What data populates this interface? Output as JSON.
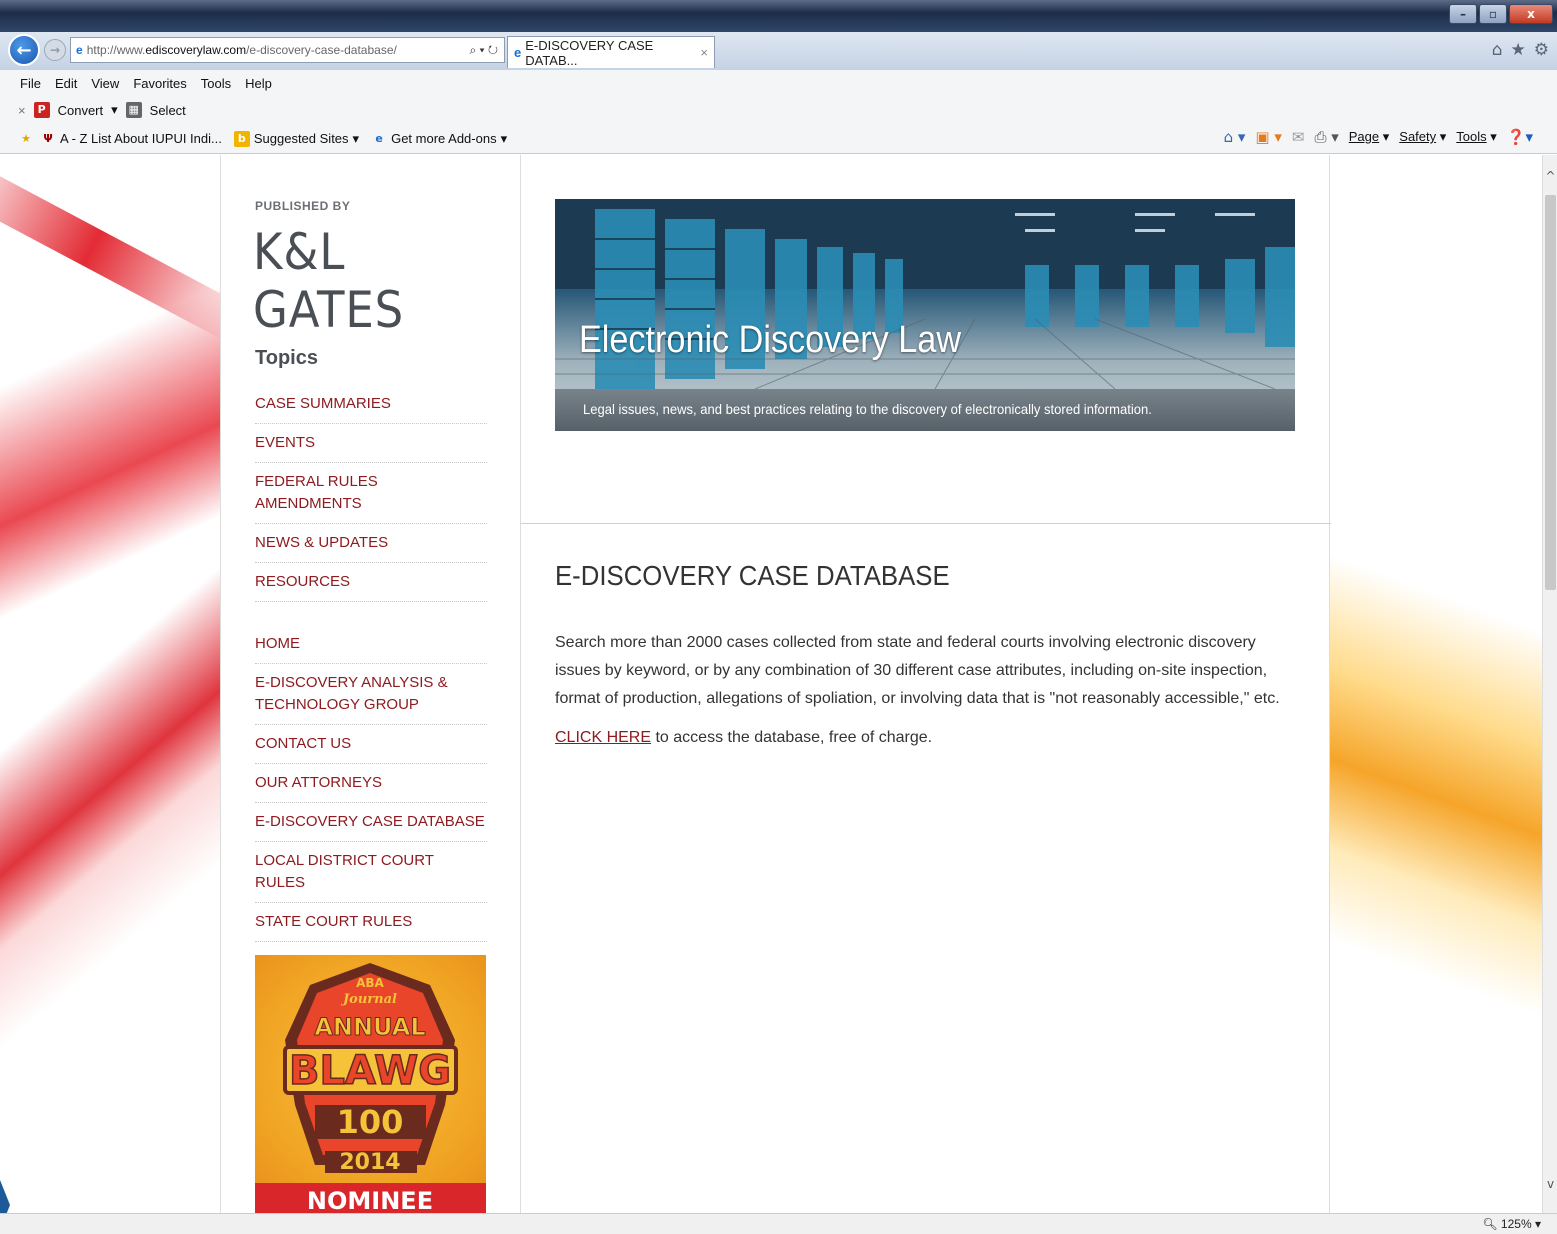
{
  "browser": {
    "url_prefix": "http://www.",
    "url_domain": "ediscoverylaw.com",
    "url_path": "/e-discovery-case-database/",
    "tab_title": "E-DISCOVERY CASE DATAB...",
    "tab_close": "×",
    "menu": [
      "File",
      "Edit",
      "View",
      "Favorites",
      "Tools",
      "Help"
    ],
    "cmd": {
      "close": "×",
      "convert": "Convert",
      "select": "Select"
    },
    "favorites": {
      "az_list": "A - Z List About IUPUI Indi...",
      "suggested": "Suggested Sites",
      "addons": "Get more Add-ons"
    },
    "right_cmds": {
      "page": "Page",
      "safety": "Safety",
      "tools": "Tools"
    },
    "zoom": "125%"
  },
  "sidebar": {
    "published_by": "PUBLISHED BY",
    "logo": "K&L GATES",
    "topics_heading": "Topics",
    "topics": [
      "CASE SUMMARIES",
      "EVENTS",
      "FEDERAL RULES AMENDMENTS",
      "NEWS & UPDATES",
      "RESOURCES"
    ],
    "links": [
      "HOME",
      "E-DISCOVERY ANALYSIS & TECHNOLOGY GROUP",
      "CONTACT US",
      "OUR ATTORNEYS",
      "E-DISCOVERY CASE DATABASE",
      "LOCAL DISTRICT COURT RULES",
      "STATE COURT RULES"
    ],
    "badge": {
      "top": "ABA",
      "journal": "Journal",
      "annual": "ANNUAL",
      "blawg": "BLAWG",
      "hundred": "100",
      "year": "2014",
      "nominee": "NOMINEE"
    }
  },
  "main": {
    "hero_title": "Electronic Discovery Law",
    "hero_tagline": "Legal issues, news, and best practices relating to the discovery of electronically stored information.",
    "page_title": "E-DISCOVERY CASE DATABASE",
    "intro": "Search more than 2000 cases collected from state and federal courts involving electronic discovery issues by keyword, or by any combination of 30 different case attributes, including on-site inspection, format of production, allegations of spoliation, or involving data that is \"not reasonably accessible,\" etc.",
    "click_here": "CLICK HERE",
    "access_rest": " to access the database, free of charge."
  }
}
